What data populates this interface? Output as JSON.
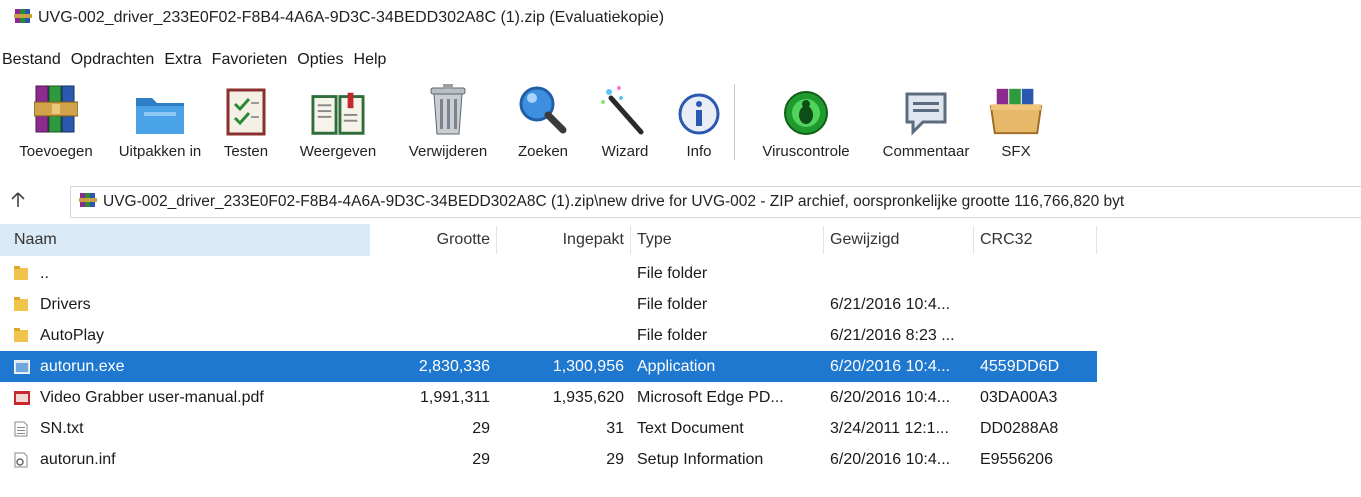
{
  "window": {
    "title": "UVG-002_driver_233E0F02-F8B4-4A6A-9D3C-34BEDD302A8C (1).zip (Evaluatiekopie)"
  },
  "menu": [
    "Bestand",
    "Opdrachten",
    "Extra",
    "Favorieten",
    "Opties",
    "Help"
  ],
  "toolbar": [
    {
      "label": "Toevoegen",
      "icon": "books-stack-icon"
    },
    {
      "label": "Uitpakken in",
      "icon": "folder-icon"
    },
    {
      "label": "Testen",
      "icon": "checklist-icon"
    },
    {
      "label": "Weergeven",
      "icon": "open-book-icon"
    },
    {
      "label": "Verwijderen",
      "icon": "trash-icon"
    },
    {
      "label": "Zoeken",
      "icon": "magnifier-icon"
    },
    {
      "label": "Wizard",
      "icon": "magic-wand-icon"
    },
    {
      "label": "Info",
      "icon": "info-icon"
    },
    {
      "label": "Viruscontrole",
      "icon": "bug-icon"
    },
    {
      "label": "Commentaar",
      "icon": "comment-icon"
    },
    {
      "label": "SFX",
      "icon": "sfx-box-icon"
    }
  ],
  "address": {
    "path": "UVG-002_driver_233E0F02-F8B4-4A6A-9D3C-34BEDD302A8C (1).zip\\new drive for UVG-002 - ZIP archief, oorspronkelijke grootte 116,766,820 byt",
    "up_icon": "up-arrow-icon"
  },
  "columns": {
    "name": "Naam",
    "size": "Grootte",
    "packed": "Ingepakt",
    "type": "Type",
    "modified": "Gewijzigd",
    "crc": "CRC32"
  },
  "files": [
    {
      "name": "..",
      "size": "",
      "packed": "",
      "type": "File folder",
      "modified": "",
      "crc": "",
      "icon": "folder-icon"
    },
    {
      "name": "Drivers",
      "size": "",
      "packed": "",
      "type": "File folder",
      "modified": "6/21/2016 10:4...",
      "crc": "",
      "icon": "folder-icon"
    },
    {
      "name": "AutoPlay",
      "size": "",
      "packed": "",
      "type": "File folder",
      "modified": "6/21/2016 8:23 ...",
      "crc": "",
      "icon": "folder-icon"
    },
    {
      "name": "autorun.exe",
      "size": "2,830,336",
      "packed": "1,300,956",
      "type": "Application",
      "modified": "6/20/2016 10:4...",
      "crc": "4559DD6D",
      "icon": "exe-icon",
      "selected": true
    },
    {
      "name": "Video Grabber user-manual.pdf",
      "size": "1,991,311",
      "packed": "1,935,620",
      "type": "Microsoft Edge PD...",
      "modified": "6/20/2016 10:4...",
      "crc": "03DA00A3",
      "icon": "pdf-icon"
    },
    {
      "name": "SN.txt",
      "size": "29",
      "packed": "31",
      "type": "Text Document",
      "modified": "3/24/2011 12:1...",
      "crc": "DD0288A8",
      "icon": "text-file-icon"
    },
    {
      "name": "autorun.inf",
      "size": "29",
      "packed": "29",
      "type": "Setup Information",
      "modified": "6/20/2016 10:4...",
      "crc": "E9556206",
      "icon": "settings-file-icon"
    }
  ],
  "colors": {
    "selection": "#1f78cf",
    "header_name_bg": "#dbeaf7"
  }
}
